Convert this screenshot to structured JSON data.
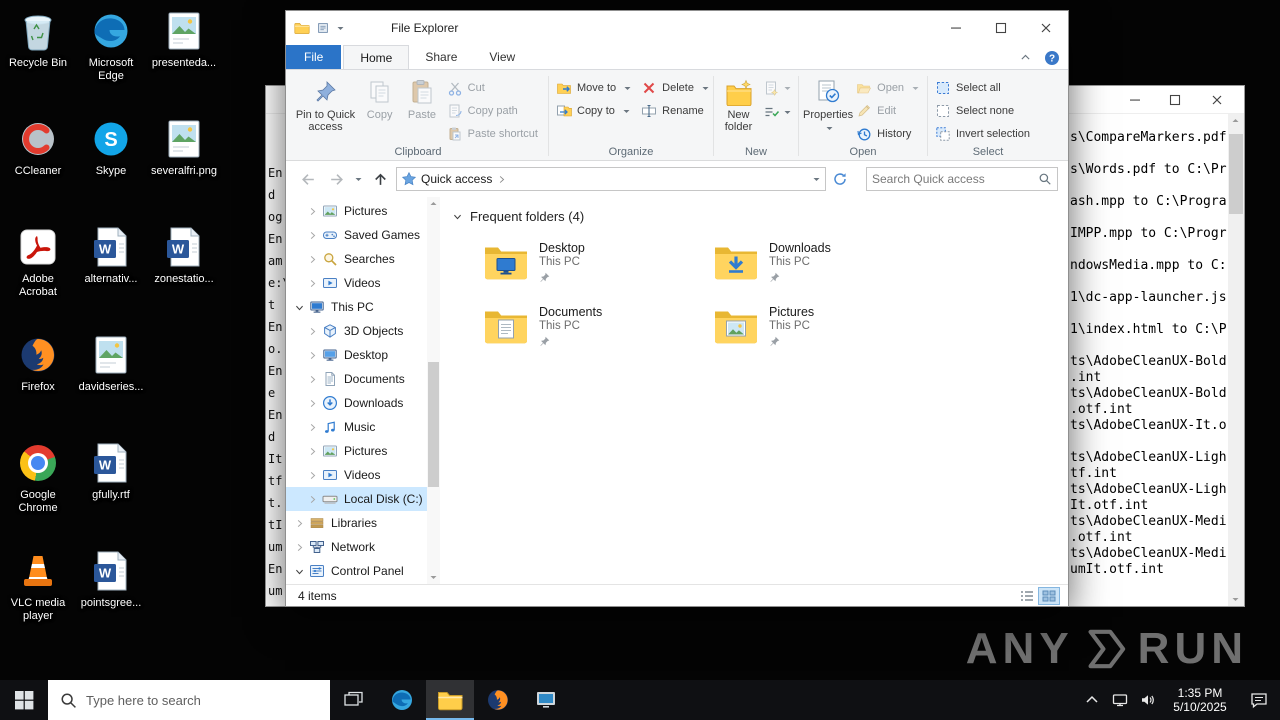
{
  "colors": {
    "file_tab_blue": "#2b74c8",
    "nav_selection": "#cce8ff",
    "folder_yellow": "#ffd45f",
    "taskbar_bg": "#0f1013",
    "watermark_grey": "#6f6f6f"
  },
  "desktop": {
    "icons": [
      {
        "name": "recycle-bin",
        "label": "Recycle Bin",
        "col": 0,
        "row": 0,
        "kind": "recycle"
      },
      {
        "name": "microsoft-edge",
        "label": "Microsoft Edge",
        "col": 1,
        "row": 0,
        "kind": "edge-logo"
      },
      {
        "name": "presenteda-png",
        "label": "presenteda...",
        "col": 2,
        "row": 0,
        "kind": "image-file"
      },
      {
        "name": "ccleaner",
        "label": "CCleaner",
        "col": 0,
        "row": 1,
        "kind": "ccleaner"
      },
      {
        "name": "skype",
        "label": "Skype",
        "col": 1,
        "row": 1,
        "kind": "skype"
      },
      {
        "name": "severalfri-png",
        "label": "severalfri.png",
        "col": 2,
        "row": 1,
        "kind": "image-file"
      },
      {
        "name": "adobe-acrobat",
        "label": "Adobe Acrobat",
        "col": 0,
        "row": 2,
        "kind": "acrobat"
      },
      {
        "name": "alternativ-doc",
        "label": "alternativ...",
        "col": 1,
        "row": 2,
        "kind": "word-doc"
      },
      {
        "name": "zonestatio-doc",
        "label": "zonestatio...",
        "col": 2,
        "row": 2,
        "kind": "word-doc"
      },
      {
        "name": "firefox",
        "label": "Firefox",
        "col": 0,
        "row": 3,
        "kind": "firefox-logo"
      },
      {
        "name": "davidseries-img",
        "label": "davidseries...",
        "col": 1,
        "row": 3,
        "kind": "image-file"
      },
      {
        "name": "google-chrome",
        "label": "Google Chrome",
        "col": 0,
        "row": 4,
        "kind": "chrome"
      },
      {
        "name": "gfully-rtf",
        "label": "gfully.rtf",
        "col": 1,
        "row": 4,
        "kind": "word-doc"
      },
      {
        "name": "vlc-media-player",
        "label": "VLC media player",
        "col": 0,
        "row": 5,
        "kind": "vlc"
      },
      {
        "name": "pointsgree-doc",
        "label": "pointsgree...",
        "col": 1,
        "row": 5,
        "kind": "word-doc"
      }
    ]
  },
  "left_window": {
    "chars": [
      "En",
      "d",
      "og",
      "En",
      "am",
      "e:\\",
      "t",
      "En",
      "o.",
      "En",
      "e",
      "En",
      "d",
      "It",
      "tf",
      "t.",
      "tI",
      "um",
      "En",
      "um"
    ]
  },
  "right_window": {
    "lines": [
      "s\\CompareMarkers.pdf",
      "",
      "s\\Words.pdf to C:\\Pr",
      "",
      "ash.mpp to C:\\Progra",
      "",
      "IMPP.mpp to C:\\Progr",
      "",
      "ndowsMedia.mpp to C:",
      "",
      "1\\dc-app-launcher.js",
      "",
      "1\\index.html to C:\\P",
      "",
      "ts\\AdobeCleanUX-Bold",
      ".int",
      "ts\\AdobeCleanUX-Bold",
      ".otf.int",
      "ts\\AdobeCleanUX-It.o",
      "",
      "ts\\AdobeCleanUX-Ligh",
      "tf.int",
      "ts\\AdobeCleanUX-Ligh",
      "It.otf.int",
      "ts\\AdobeCleanUX-Medi",
      ".otf.int",
      "ts\\AdobeCleanUX-Medi",
      "umIt.otf.int"
    ]
  },
  "watermark": {
    "brand_left": "ANY",
    "brand_right": "RUN"
  },
  "explorer": {
    "title": "File Explorer",
    "tabs": [
      {
        "label": "File",
        "file": true
      },
      {
        "label": "Home",
        "active": true
      },
      {
        "label": "Share"
      },
      {
        "label": "View"
      }
    ],
    "ribbon": {
      "clipboard": {
        "group": "Clipboard",
        "pin": "Pin to Quick access",
        "copy": "Copy",
        "paste": "Paste",
        "cut": "Cut",
        "copy_path": "Copy path",
        "paste_shortcut": "Paste shortcut"
      },
      "organize": {
        "group": "Organize",
        "move_to": "Move to",
        "copy_to": "Copy to",
        "delete": "Delete",
        "rename": "Rename"
      },
      "new": {
        "group": "New",
        "new_folder": "New folder"
      },
      "open": {
        "group": "Open",
        "properties": "Properties",
        "open": "Open",
        "edit": "Edit",
        "history": "History"
      },
      "select": {
        "group": "Select",
        "select_all": "Select all",
        "select_none": "Select none",
        "invert": "Invert selection"
      }
    },
    "address": {
      "breadcrumb": "Quick access",
      "search_placeholder": "Search Quick access"
    },
    "nav": [
      {
        "label": "Pictures",
        "indent": 1,
        "icon": "nav-pictures"
      },
      {
        "label": "Saved Games",
        "indent": 1,
        "icon": "nav-saved-games"
      },
      {
        "label": "Searches",
        "indent": 1,
        "icon": "nav-searches"
      },
      {
        "label": "Videos",
        "indent": 1,
        "icon": "nav-videos"
      },
      {
        "label": "This PC",
        "indent": 0,
        "expanded": true,
        "icon": "nav-pc"
      },
      {
        "label": "3D Objects",
        "indent": 1,
        "icon": "nav-3d"
      },
      {
        "label": "Desktop",
        "indent": 1,
        "icon": "nav-desktop"
      },
      {
        "label": "Documents",
        "indent": 1,
        "icon": "nav-documents"
      },
      {
        "label": "Downloads",
        "indent": 1,
        "icon": "nav-downloads"
      },
      {
        "label": "Music",
        "indent": 1,
        "icon": "nav-music"
      },
      {
        "label": "Pictures",
        "indent": 1,
        "icon": "nav-pictures"
      },
      {
        "label": "Videos",
        "indent": 1,
        "icon": "nav-videos"
      },
      {
        "label": "Local Disk (C:)",
        "indent": 1,
        "icon": "nav-drive",
        "selected": true
      },
      {
        "label": "Libraries",
        "indent": 0,
        "icon": "nav-libraries"
      },
      {
        "label": "Network",
        "indent": 0,
        "icon": "nav-network"
      },
      {
        "label": "Control Panel",
        "indent": 0,
        "expanded": true,
        "icon": "nav-control"
      }
    ],
    "content": {
      "section_title": "Frequent folders (4)",
      "tiles": [
        {
          "title": "Desktop",
          "subtitle": "This PC",
          "icon": "tile-desktop",
          "pinned": true
        },
        {
          "title": "Downloads",
          "subtitle": "This PC",
          "icon": "tile-downloads",
          "pinned": true
        },
        {
          "title": "Documents",
          "subtitle": "This PC",
          "icon": "tile-documents",
          "pinned": true
        },
        {
          "title": "Pictures",
          "subtitle": "This PC",
          "icon": "tile-pictures",
          "pinned": true
        }
      ]
    },
    "status": {
      "items": "4 items"
    }
  },
  "taskbar": {
    "search_placeholder": "Type here to search",
    "apps": [
      {
        "name": "edge",
        "icon": "edge-task"
      },
      {
        "name": "file-explorer",
        "icon": "explorer-task",
        "active": true
      },
      {
        "name": "firefox",
        "icon": "firefox-task"
      },
      {
        "name": "app-window",
        "icon": "appwin"
      }
    ],
    "clock": {
      "time": "1:35 PM",
      "date": "5/10/2025"
    }
  }
}
